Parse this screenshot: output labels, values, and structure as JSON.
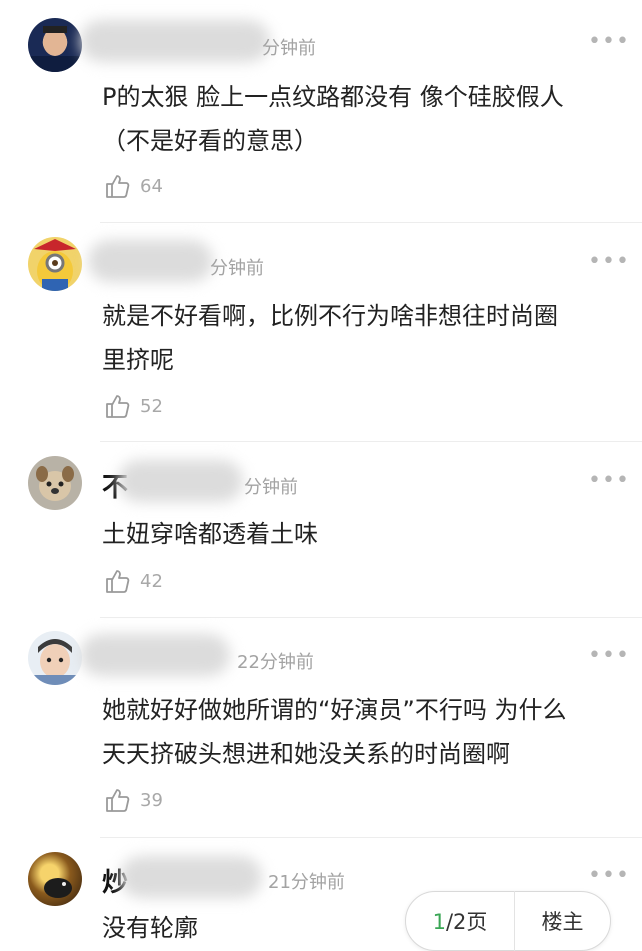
{
  "comments": [
    {
      "name_visible": "",
      "time": "分钟前",
      "text_lines": [
        "P的太狠 脸上一点纹路都没有 像个硅胶假人",
        "（不是好看的意思）"
      ],
      "likes": "64"
    },
    {
      "name_visible": "",
      "time": "分钟前",
      "text_lines": [
        "就是不好看啊，比例不行为啥非想往时尚圈",
        "里挤呢"
      ],
      "likes": "52"
    },
    {
      "name_visible": "不",
      "time": "分钟前",
      "text_lines": [
        "土妞穿啥都透着土味"
      ],
      "likes": "42"
    },
    {
      "name_visible": "",
      "time": "22分钟前",
      "text_lines": [
        "她就好好做她所谓的“好演员”不行吗 为什么",
        "天天挤破头想进和她没关系的时尚圈啊"
      ],
      "likes": "39"
    },
    {
      "name_visible": "炒",
      "time": "21分钟前",
      "text_lines": [
        "没有轮廓"
      ],
      "likes": ""
    }
  ],
  "more_label": "•••",
  "pager": {
    "current": "1",
    "total_suffix": "/2页",
    "owner_label": "楼主"
  },
  "icons": {
    "like": "thumbs-up-icon",
    "more": "more-dots-icon"
  },
  "colors": {
    "time": "#a3a3a3",
    "like": "#a8a8a8",
    "pager_current": "#3aa655"
  }
}
